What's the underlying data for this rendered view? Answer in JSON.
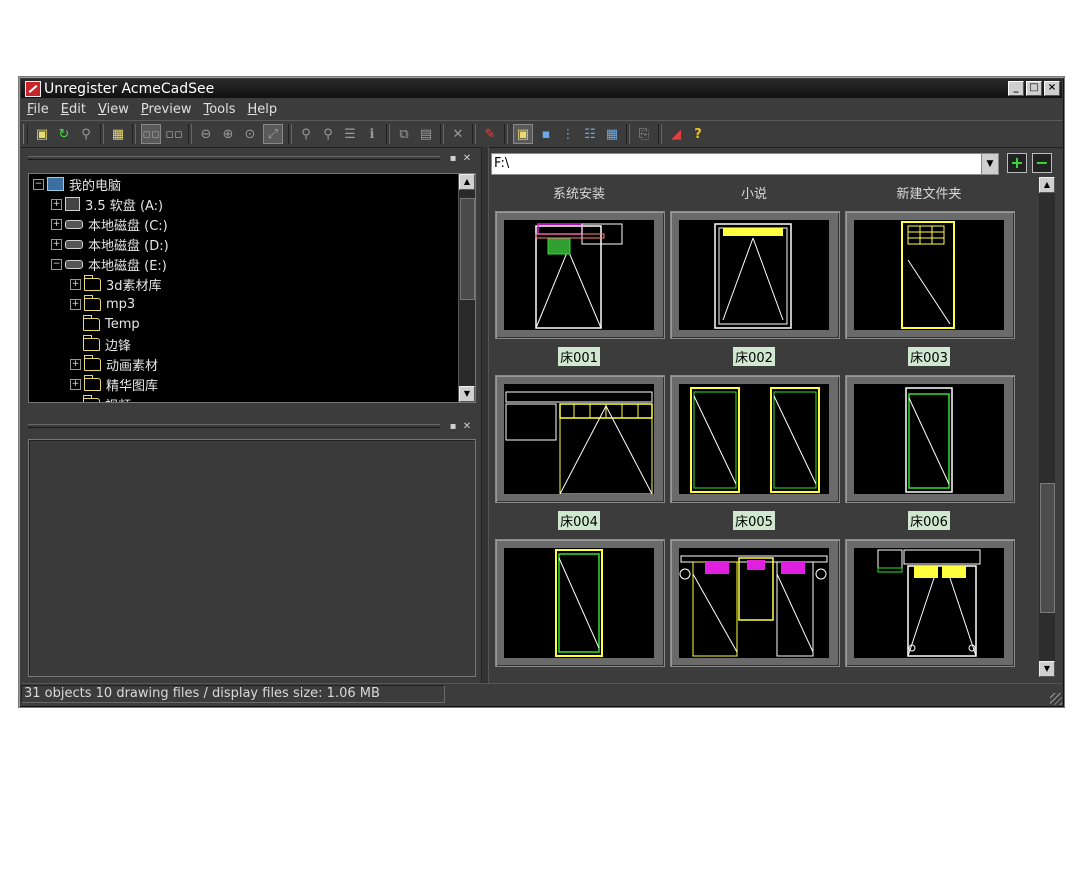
{
  "window": {
    "title": "Unregister AcmeCadSee",
    "controls": [
      "_",
      "□",
      "×"
    ]
  },
  "menu": [
    {
      "label": "File",
      "key": "F"
    },
    {
      "label": "Edit",
      "key": "E"
    },
    {
      "label": "View",
      "key": "V"
    },
    {
      "label": "Preview",
      "key": "P"
    },
    {
      "label": "Tools",
      "key": "T"
    },
    {
      "label": "Help",
      "key": "H"
    }
  ],
  "toolbar": [
    "up-folder-icon",
    "refresh-icon",
    "find-icon",
    "properties-icon",
    "thumbnails-view-icon",
    "thumbnails-view-2-icon",
    "zoom-out-icon",
    "zoom-in-icon",
    "zoom-window-icon",
    "zoom-extents-icon",
    "zoom-realtime-icon",
    "zoom-prev-icon",
    "layers-icon",
    "info-icon",
    "copy-icon",
    "paste-icon",
    "delete-icon",
    "options-icon",
    "large-icons-icon",
    "small-icons-icon",
    "list-icon",
    "details-icon",
    "grid-icon",
    "convert-icon",
    "acme-icon",
    "help-icon"
  ],
  "tree": {
    "items": [
      {
        "label": "我的电脑",
        "icon": "computer-icon",
        "level": 0,
        "expander": "−"
      },
      {
        "label": "3.5 软盘 (A:)",
        "icon": "floppy-icon",
        "level": 1,
        "expander": "+"
      },
      {
        "label": "本地磁盘 (C:)",
        "icon": "drive-icon",
        "level": 1,
        "expander": "+"
      },
      {
        "label": "本地磁盘 (D:)",
        "icon": "drive-icon",
        "level": 1,
        "expander": "+"
      },
      {
        "label": "本地磁盘 (E:)",
        "icon": "drive-icon",
        "level": 1,
        "expander": "−"
      },
      {
        "label": "3d素材库",
        "icon": "folder-icon",
        "level": 2,
        "expander": "+"
      },
      {
        "label": "mp3",
        "icon": "folder-icon",
        "level": 2,
        "expander": "+"
      },
      {
        "label": "Temp",
        "icon": "folder-icon",
        "level": 2,
        "expander": ""
      },
      {
        "label": "边锋",
        "icon": "folder-icon",
        "level": 2,
        "expander": ""
      },
      {
        "label": "动画素材",
        "icon": "folder-icon",
        "level": 2,
        "expander": "+"
      },
      {
        "label": "精华图库",
        "icon": "folder-icon",
        "level": 2,
        "expander": "+"
      },
      {
        "label": "视频",
        "icon": "folder-icon",
        "level": 2,
        "expander": ""
      }
    ]
  },
  "path": {
    "value": "F:\\"
  },
  "folders": [
    "系统安装",
    "小说",
    "新建文件夹"
  ],
  "files": [
    "床001",
    "床002",
    "床003",
    "床004",
    "床005",
    "床006"
  ],
  "status": {
    "text": "31 objects 10 drawing files / display files size: 1.06 MB"
  },
  "colors": {
    "drawing_yellow": "#ffff40",
    "drawing_green": "#30e030",
    "drawing_magenta": "#e020e0",
    "label_bg": "#cfe8cf"
  }
}
